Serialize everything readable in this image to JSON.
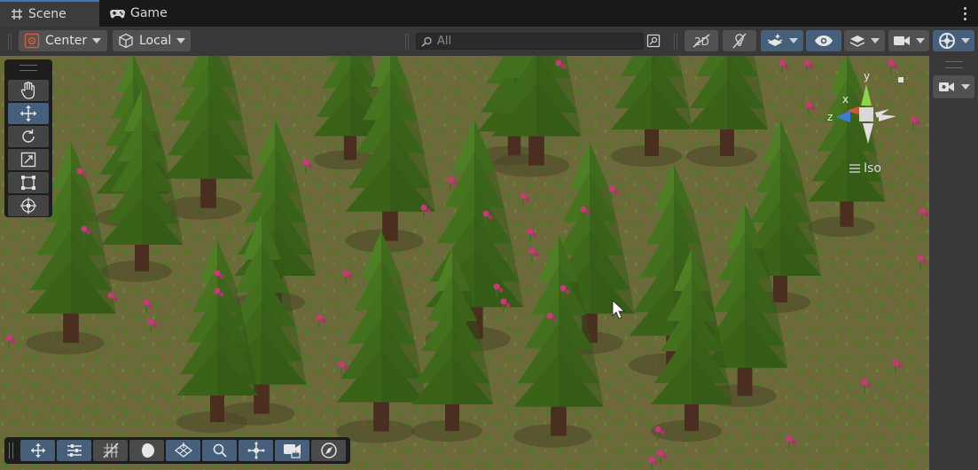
{
  "tabs": [
    {
      "label": "Scene",
      "icon": "grid-icon",
      "active": true
    },
    {
      "label": "Game",
      "icon": "gamepad-icon",
      "active": false
    }
  ],
  "toolbar": {
    "pivot_mode": "Center",
    "pivot_rotation": "Local",
    "search_placeholder": "All"
  },
  "overlay": {
    "projection_label": "Iso",
    "axis_labels": {
      "x": "x",
      "y": "y",
      "z": "z"
    }
  },
  "tools": [
    "hand-tool",
    "move-tool",
    "rotate-tool",
    "scale-tool",
    "rect-tool",
    "transform-tool"
  ],
  "active_tool": "move-tool",
  "colors": {
    "accent_blue": "#46607c",
    "panel_dark": "#1d1d1d",
    "toolbar_bg": "#383838",
    "ground": "#6e6b3c",
    "tree_foliage": "#3f6b1d",
    "flower": "#d0357c"
  }
}
